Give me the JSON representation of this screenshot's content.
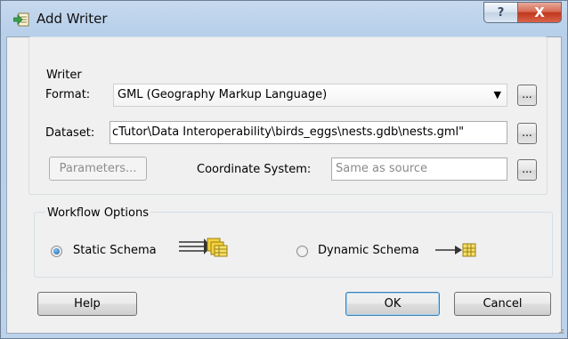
{
  "window": {
    "title": "Add Writer",
    "help_button": "?",
    "close_button": "X"
  },
  "writer_group": {
    "label": "Writer",
    "format_label": "Format:",
    "format_value": "GML (Geography Markup Language)",
    "dataset_label": "Dataset:",
    "dataset_value": "cTutor\\Data Interoperability\\birds_eggs\\nests.gdb\\nests.gml\"",
    "parameters_button": "Parameters...",
    "coord_label": "Coordinate System:",
    "coord_placeholder": "Same as source",
    "browse_label": "..."
  },
  "workflow_group": {
    "label": "Workflow Options",
    "static_label": "Static Schema",
    "dynamic_label": "Dynamic Schema",
    "selected": "Static Schema"
  },
  "buttons": {
    "help": "Help",
    "ok": "OK",
    "cancel": "Cancel"
  },
  "colors": {
    "title_gradient": "#c6d9ee",
    "close_red": "#c0371c",
    "dialog_bg": "#f0f0f0",
    "icon_yellow": "#f3d23c",
    "icon_green": "#3ba14a"
  }
}
